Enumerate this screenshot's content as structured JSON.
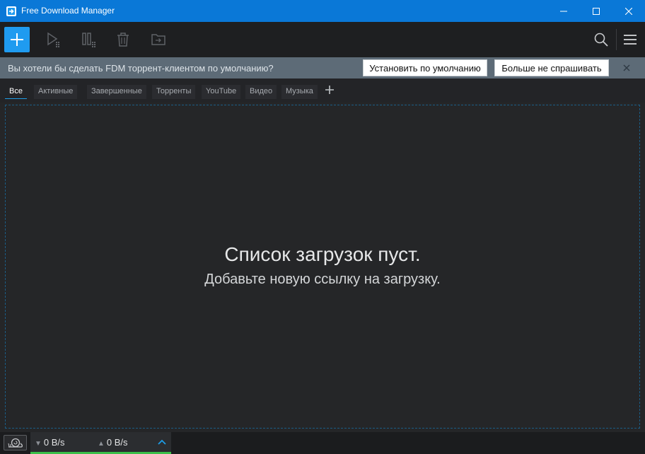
{
  "window": {
    "title": "Free Download Manager",
    "accent": "#0a78d7"
  },
  "toolbar": {
    "icons": [
      "plus-icon",
      "play-icon",
      "pause-icon",
      "trash-icon",
      "folder-move-icon",
      "search-icon",
      "hamburger-menu-icon"
    ]
  },
  "banner": {
    "message": "Вы хотели бы сделать FDM торрент-клиентом по умолчанию?",
    "set_default_label": "Установить по умолчанию",
    "dont_ask_label": "Больше не спрашивать"
  },
  "tabs": [
    {
      "label": "Все",
      "active": true
    },
    {
      "label": "Активные",
      "active": false
    },
    {
      "label": "Завершенные",
      "active": false
    },
    {
      "label": "Торренты",
      "active": false
    },
    {
      "label": "YouTube",
      "active": false
    },
    {
      "label": "Видео",
      "active": false
    },
    {
      "label": "Музыка",
      "active": false
    }
  ],
  "main": {
    "empty_title": "Список загрузок пуст.",
    "empty_subtitle": "Добавьте новую ссылку на загрузку."
  },
  "status": {
    "download_speed": "0 B/s",
    "upload_speed": "0 B/s",
    "bar_color": "#3bbf4a"
  }
}
